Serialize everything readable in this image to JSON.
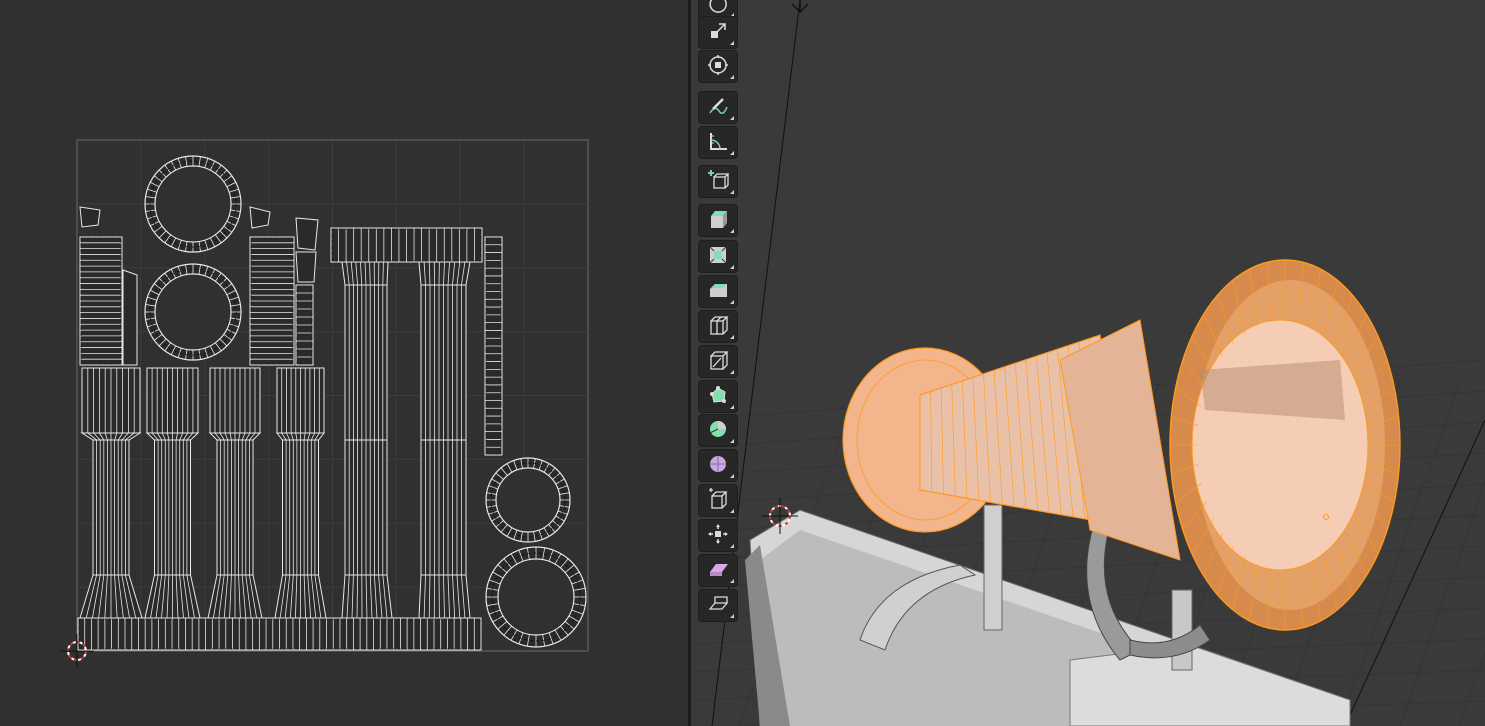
{
  "app": {
    "left_editor": "uv-editor",
    "right_editor": "3d-viewport"
  },
  "colors": {
    "background": "#303030",
    "viewport_background": "#3a3a3a",
    "uv_grid_line": "#3c3c3c",
    "uv_bounds": "#6a6a6a",
    "uv_edge": "#0d0d0d",
    "uv_edge_highlight": "#e8e8e8",
    "selected_mesh": "#f2b58c",
    "selected_edge": "#ff9a1f",
    "unselected_mesh": "#c8c8c8",
    "cursor_red": "#d33333"
  },
  "toolbar": {
    "tools": [
      {
        "name": "rotate",
        "icon": "rotate-icon"
      },
      {
        "name": "scale",
        "icon": "scale-icon"
      },
      {
        "name": "transform",
        "icon": "transform-icon"
      },
      {
        "name": "annotate",
        "icon": "annotate-icon"
      },
      {
        "name": "measure",
        "icon": "measure-icon"
      },
      {
        "name": "add-cube",
        "icon": "add-cube-icon"
      },
      {
        "name": "extrude-region",
        "icon": "extrude-region-icon"
      },
      {
        "name": "inset-faces",
        "icon": "inset-faces-icon"
      },
      {
        "name": "bevel",
        "icon": "bevel-icon"
      },
      {
        "name": "loop-cut",
        "icon": "loop-cut-icon"
      },
      {
        "name": "knife",
        "icon": "knife-icon"
      },
      {
        "name": "poly-build",
        "icon": "poly-build-icon"
      },
      {
        "name": "spin",
        "icon": "spin-icon"
      },
      {
        "name": "smooth",
        "icon": "smooth-icon"
      },
      {
        "name": "edge-slide",
        "icon": "edge-slide-icon"
      },
      {
        "name": "shrink-fatten",
        "icon": "shrink-fatten-icon"
      },
      {
        "name": "shear",
        "icon": "shear-icon"
      },
      {
        "name": "rip-region",
        "icon": "rip-region-icon"
      }
    ]
  }
}
